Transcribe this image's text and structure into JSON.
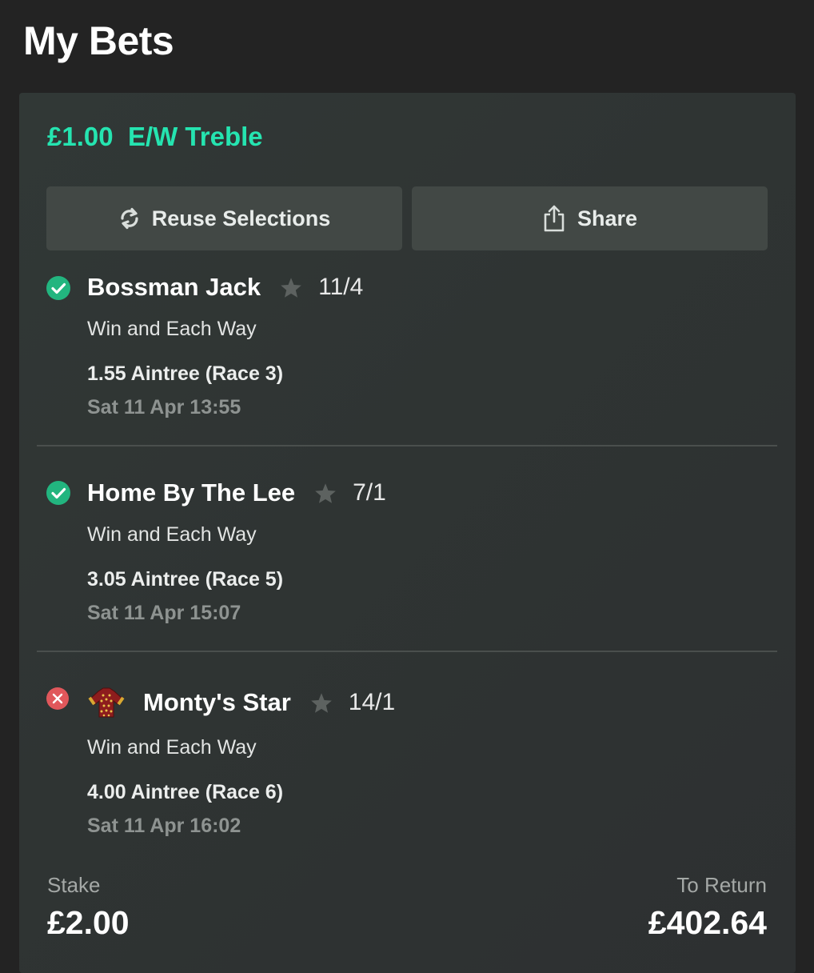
{
  "page": {
    "title": "My Bets"
  },
  "bet": {
    "stake_amount": "£1.00",
    "bet_type": "E/W Treble",
    "accent_color": "#25e4b0"
  },
  "actions": {
    "reuse_label": "Reuse Selections",
    "reuse_icon": "refresh-icon",
    "share_label": "Share",
    "share_icon": "share-icon"
  },
  "selections": [
    {
      "status": "won",
      "status_icon": "check-circle-icon",
      "status_color": "#22b57f",
      "has_silks": false,
      "horse": "Bossman Jack",
      "odds": "11/4",
      "market": "Win and Each Way",
      "race": "1.55 Aintree (Race 3)",
      "time": "Sat 11 Apr 13:55"
    },
    {
      "status": "won",
      "status_icon": "check-circle-icon",
      "status_color": "#22b57f",
      "has_silks": false,
      "horse": "Home By The Lee",
      "odds": "7/1",
      "market": "Win and Each Way",
      "race": "3.05 Aintree (Race 5)",
      "time": "Sat 11 Apr 15:07"
    },
    {
      "status": "lost",
      "status_icon": "cross-circle-icon",
      "status_color": "#e0575b",
      "has_silks": true,
      "silks_icon": "jockey-silks-icon",
      "horse": "Monty's Star",
      "odds": "14/1",
      "market": "Win and Each Way",
      "race": "4.00 Aintree (Race 6)",
      "time": "Sat 11 Apr 16:02"
    }
  ],
  "footer": {
    "stake_label": "Stake",
    "stake_value": "£2.00",
    "return_label": "To Return",
    "return_value": "£402.64"
  }
}
